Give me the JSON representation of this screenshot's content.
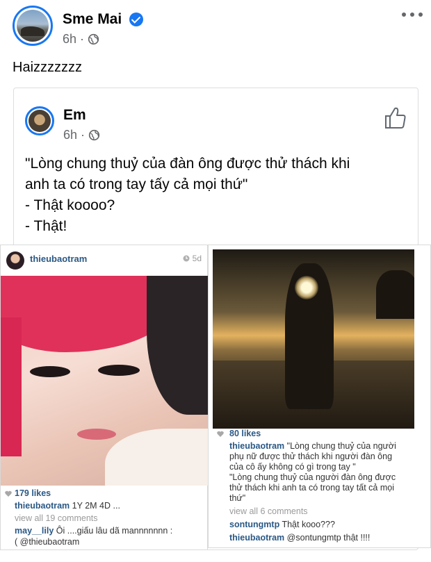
{
  "post": {
    "author": "Sme Mai",
    "time": "6h",
    "time_sep": "·",
    "text": "Haizzzzzzz"
  },
  "shared": {
    "author": "Em",
    "time": "6h",
    "time_sep": "·",
    "quote_lines": [
      "\"Lòng chung thuỷ của đàn ông được thử thách khi",
      "anh ta có trong tay tấy cả mọi thứ\"",
      "- Thật koooo?",
      "- Thật!"
    ]
  },
  "ig_left": {
    "username": "thieubaotram",
    "age": "5d",
    "likes": "179 likes",
    "caption_user": "thieubaotram",
    "caption_text": "1Y 2M 4D ...",
    "view_comments": "view all 19 comments",
    "comment_user": "may__lily",
    "comment_text": "Ôi ....giấu lâu dã mannnnnnn :",
    "comment_cont": "( @thieubaotram"
  },
  "ig_right": {
    "likes": "80 likes",
    "caption_user": "thieubaotram",
    "caption_lines": [
      "\"Lòng chung thuỷ của người",
      "phụ nữ được thử thách khi người đàn ông",
      "của cô ấy không có gì trong tay \"",
      "\"Lòng chung thuỷ của người đàn ông được",
      "thử thách khi anh ta có trong tay tất cả mọi",
      "thứ\""
    ],
    "view_comments": "view all 6 comments",
    "comment1_user": "sontungmtp",
    "comment1_text": "Thật kooo???",
    "comment2_user": "thieubaotram",
    "comment2_text": "@sontungmtp thật !!!!"
  },
  "icons": {
    "verified": "verified-badge-icon",
    "globe": "globe-icon",
    "more": "more-options-icon",
    "like": "thumbs-up-icon",
    "heart": "heart-icon",
    "clock": "clock-icon"
  },
  "colors": {
    "accent": "#1877f2",
    "meta": "#65676b",
    "ig_link": "#2a5885"
  }
}
